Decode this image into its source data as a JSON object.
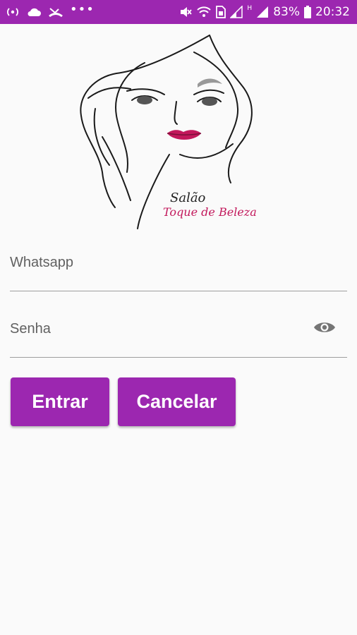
{
  "status_bar": {
    "battery": "83%",
    "time": "20:32",
    "signal_label": "H",
    "left_icons": [
      "hotspot-icon",
      "cloud-icon",
      "missed-call-icon",
      "more-dots-icon"
    ],
    "right_icons": [
      "mute-icon",
      "wifi-call-icon",
      "sim-icon",
      "signal-icon",
      "signal-icon",
      "battery-icon"
    ]
  },
  "logo": {
    "line1": "Salão",
    "line2": "Toque de Beleza"
  },
  "form": {
    "whatsapp_placeholder": "Whatsapp",
    "password_placeholder": "Senha"
  },
  "buttons": {
    "login_label": "Entrar",
    "cancel_label": "Cancelar"
  },
  "colors": {
    "primary": "#9c27b0",
    "lips": "#c2185b"
  }
}
